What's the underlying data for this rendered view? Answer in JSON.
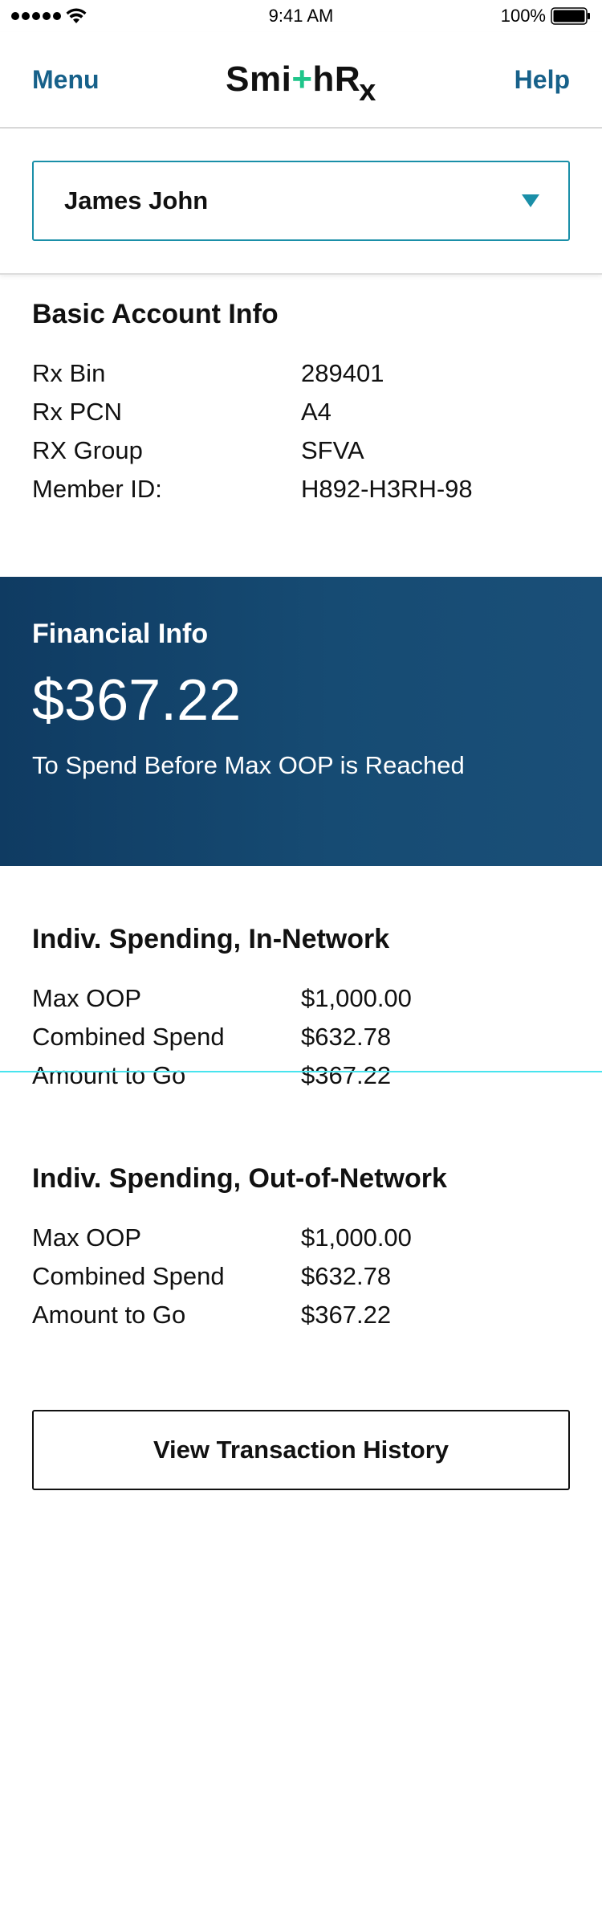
{
  "status_bar": {
    "time": "9:41 AM",
    "battery": "100%",
    "signal_icon": "signal-dots-icon",
    "wifi_icon": "wifi-icon",
    "battery_icon": "battery-icon"
  },
  "header": {
    "menu_label": "Menu",
    "help_label": "Help",
    "logo": {
      "part1": "Smi",
      "plus": "+",
      "part2": "hR",
      "part3": "x"
    },
    "accent_color": "#17618a",
    "logo_plus_color": "#1fc58a"
  },
  "member_selector": {
    "selected": "James John",
    "icon": "chevron-down-icon"
  },
  "basic_info": {
    "title": "Basic Account Info",
    "rows": [
      {
        "label": "Rx Bin",
        "value": "289401"
      },
      {
        "label": "Rx PCN",
        "value": "A4"
      },
      {
        "label": "RX Group",
        "value": "SFVA"
      },
      {
        "label": "Member ID:",
        "value": "H892-H3RH-98"
      }
    ]
  },
  "financial_info": {
    "title": "Financial Info",
    "amount": "$367.22",
    "caption": "To Spend Before Max OOP is Reached",
    "banner_color": "#164b73"
  },
  "in_network": {
    "title": "Indiv. Spending, In-Network",
    "rows": [
      {
        "label": "Max OOP",
        "value": "$1,000.00"
      },
      {
        "label": "Combined Spend",
        "value": "$632.78"
      },
      {
        "label": "Amount to Go",
        "value": "$367.22"
      }
    ]
  },
  "out_of_network": {
    "title": "Indiv. Spending, Out-of-Network",
    "rows": [
      {
        "label": "Max OOP",
        "value": "$1,000.00"
      },
      {
        "label": "Combined Spend",
        "value": "$632.78"
      },
      {
        "label": "Amount to Go",
        "value": "$367.22"
      }
    ]
  },
  "actions": {
    "history_button": "View Transaction History"
  }
}
